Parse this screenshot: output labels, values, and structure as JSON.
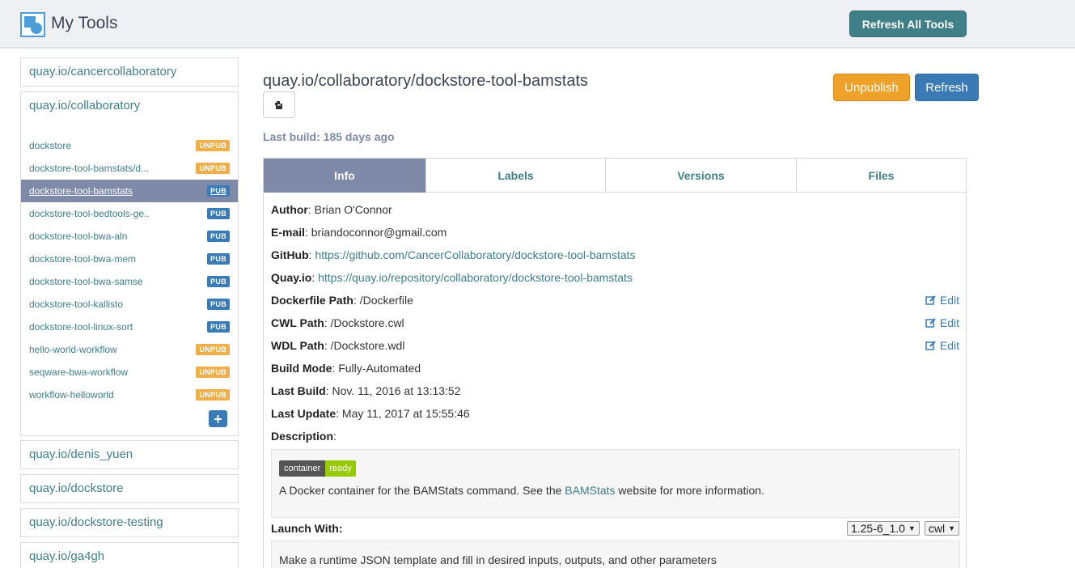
{
  "header": {
    "title": "My Tools",
    "refresh_all_label": "Refresh All Tools"
  },
  "sidebar": {
    "orgs_top": [
      "quay.io/cancercollaboratory"
    ],
    "expanded_org": {
      "name": "quay.io/collaboratory",
      "tools": [
        {
          "name": "dockstore",
          "status": "UNPUB"
        },
        {
          "name": "dockstore-tool-bamstats/d...",
          "status": "UNPUB"
        },
        {
          "name": "dockstore-tool-bamstats",
          "status": "PUB",
          "active": true
        },
        {
          "name": "dockstore-tool-bedtools-ge..",
          "status": "PUB"
        },
        {
          "name": "dockstore-tool-bwa-aln",
          "status": "PUB"
        },
        {
          "name": "dockstore-tool-bwa-mem",
          "status": "PUB"
        },
        {
          "name": "dockstore-tool-bwa-samse",
          "status": "PUB"
        },
        {
          "name": "dockstore-tool-kallisto",
          "status": "PUB"
        },
        {
          "name": "dockstore-tool-linux-sort",
          "status": "PUB"
        },
        {
          "name": "hello-world-workflow",
          "status": "UNPUB"
        },
        {
          "name": "seqware-bwa-workflow",
          "status": "UNPUB"
        },
        {
          "name": "workflow-helloworld",
          "status": "UNPUB"
        }
      ],
      "add_label": "+"
    },
    "orgs_bottom": [
      "quay.io/denis_yuen",
      "quay.io/dockstore",
      "quay.io/dockstore-testing",
      "quay.io/ga4gh"
    ]
  },
  "main": {
    "title": "quay.io/collaboratory/dockstore-tool-bamstats",
    "unpublish_label": "Unpublish",
    "refresh_label": "Refresh",
    "last_build": "Last build: 185 days ago",
    "tabs": [
      "Info",
      "Labels",
      "Versions",
      "Files"
    ],
    "info": {
      "author_label": "Author",
      "author": "Brian O'Connor",
      "email_label": "E-mail",
      "email": "briandoconnor@gmail.com",
      "github_label": "GitHub",
      "github": "https://github.com/CancerCollaboratory/dockstore-tool-bamstats",
      "quay_label": "Quay.io",
      "quay": "https://quay.io/repository/collaboratory/dockstore-tool-bamstats",
      "dockerfile_label": "Dockerfile Path",
      "dockerfile": "/Dockerfile",
      "cwl_label": "CWL Path",
      "cwl": "/Dockstore.cwl",
      "wdl_label": "WDL Path",
      "wdl": "/Dockstore.wdl",
      "mode_label": "Build Mode",
      "mode": "Fully-Automated",
      "last_build_label": "Last Build",
      "last_build": "Nov. 11, 2016 at 13:13:52",
      "last_update_label": "Last Update",
      "last_update": "May 11, 2017 at 15:55:46",
      "description_label": "Description",
      "edit_label": "Edit"
    },
    "description": {
      "shield_left": "container",
      "shield_right": "ready",
      "text_before": "A Docker container for the BAMStats command. See the ",
      "link": "BAMStats",
      "text_after": " website for more information."
    },
    "launch": {
      "label": "Launch With:",
      "version": "1.25-6_1.0",
      "descriptor": "cwl",
      "text": "Make a runtime JSON template and fill in desired inputs, outputs, and other parameters"
    }
  },
  "colors": {
    "accent": "#3f7f88",
    "active_tab": "#7e8aa8",
    "unpub_badge": "#efb04b",
    "pub_badge": "#3a7bb5",
    "unpublish_button": "#efa12a"
  }
}
